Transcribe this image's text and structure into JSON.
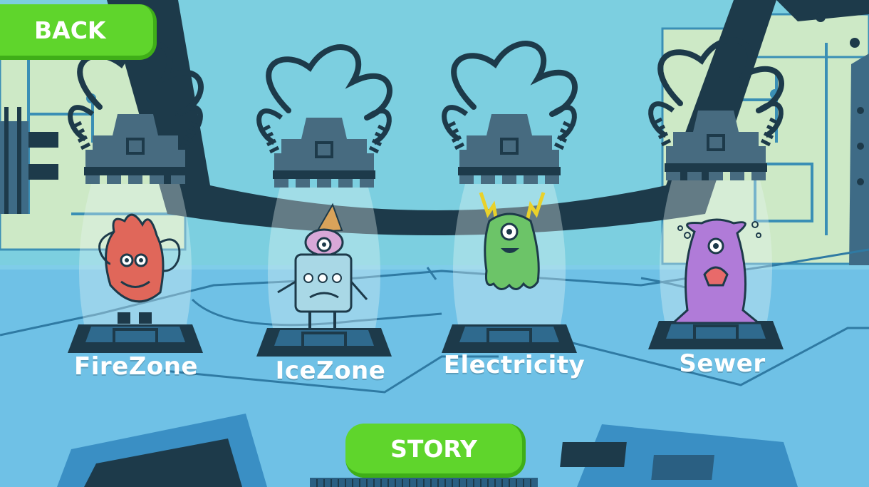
{
  "nav": {
    "back_label": "BACK"
  },
  "footer": {
    "story_label": "STORY"
  },
  "zones": [
    {
      "id": "firezone",
      "label": "FireZone"
    },
    {
      "id": "icezone",
      "label": "IceZone"
    },
    {
      "id": "electricity",
      "label": "Electricity"
    },
    {
      "id": "sewer",
      "label": "Sewer"
    }
  ],
  "colors": {
    "button_green": "#5fd52c",
    "sky": "#7ccfe0",
    "floor": "#6fc1e6",
    "dark_navy": "#1d3a4a",
    "pod_gray": "#476b80",
    "fire_monster": "#e0675a",
    "ice_monster": "#a9d8e6",
    "electric_monster": "#6cc468",
    "sewer_monster": "#b07bd8"
  }
}
